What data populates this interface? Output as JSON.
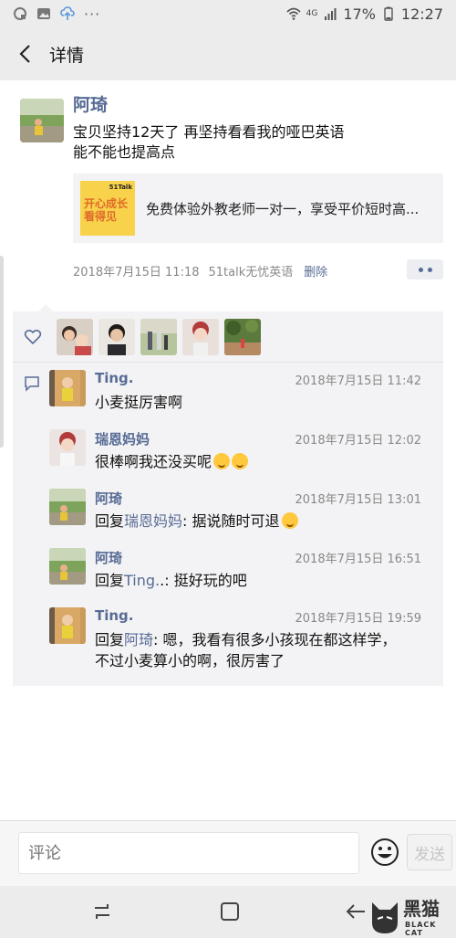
{
  "status_bar": {
    "battery": "17%",
    "time": "12:27",
    "network": "4G"
  },
  "nav": {
    "title": "详情"
  },
  "post": {
    "author": "阿琦",
    "text_line1": "宝贝坚持12天了 再坚持看看我的哑巴英语",
    "text_line2": "能不能也提高点",
    "link": {
      "title": "免费体验外教老师一对一，享受平价短时高...",
      "thumb_logo": "51Talk",
      "thumb_text_line1": "开心成长",
      "thumb_text_line2": "看得见"
    },
    "time": "2018年7月15日 11:18",
    "source": "51talk无忧英语",
    "delete_label": "删除"
  },
  "comments": [
    {
      "name": "Ting.",
      "time": "2018年7月15日 11:42",
      "text": "小麦挺厉害啊",
      "reply_to": "",
      "avatar": "child-door"
    },
    {
      "name": "瑞恩妈妈",
      "time": "2018年7月15日 12:02",
      "text": "很棒啊我还没买呢",
      "reply_to": "",
      "avatar": "doll-red"
    },
    {
      "name": "阿琦",
      "time": "2018年7月15日 13:01",
      "prefix": "回复",
      "reply_to": "瑞恩妈妈",
      "text": ": 据说随时可退",
      "avatar": "child-park"
    },
    {
      "name": "阿琦",
      "time": "2018年7月15日 16:51",
      "prefix": "回复",
      "reply_to": "Ting.",
      "text": ".: 挺好玩的吧",
      "avatar": "child-park"
    },
    {
      "name": "Ting.",
      "time": "2018年7月15日 19:59",
      "prefix": "回复",
      "reply_to": "阿琦",
      "text": ": 嗯，我看有很多小孩现在都这样学，",
      "text_line2": "不过小麦算小的啊，很厉害了",
      "avatar": "child-door"
    }
  ],
  "input": {
    "placeholder": "评论",
    "send_label": "发送"
  },
  "watermark": {
    "text": "黑猫",
    "sub": "BLACK CAT"
  },
  "colors": {
    "link_blue": "#576b95",
    "panel_bg": "#f3f3f5",
    "bar_bg": "#ececec"
  }
}
